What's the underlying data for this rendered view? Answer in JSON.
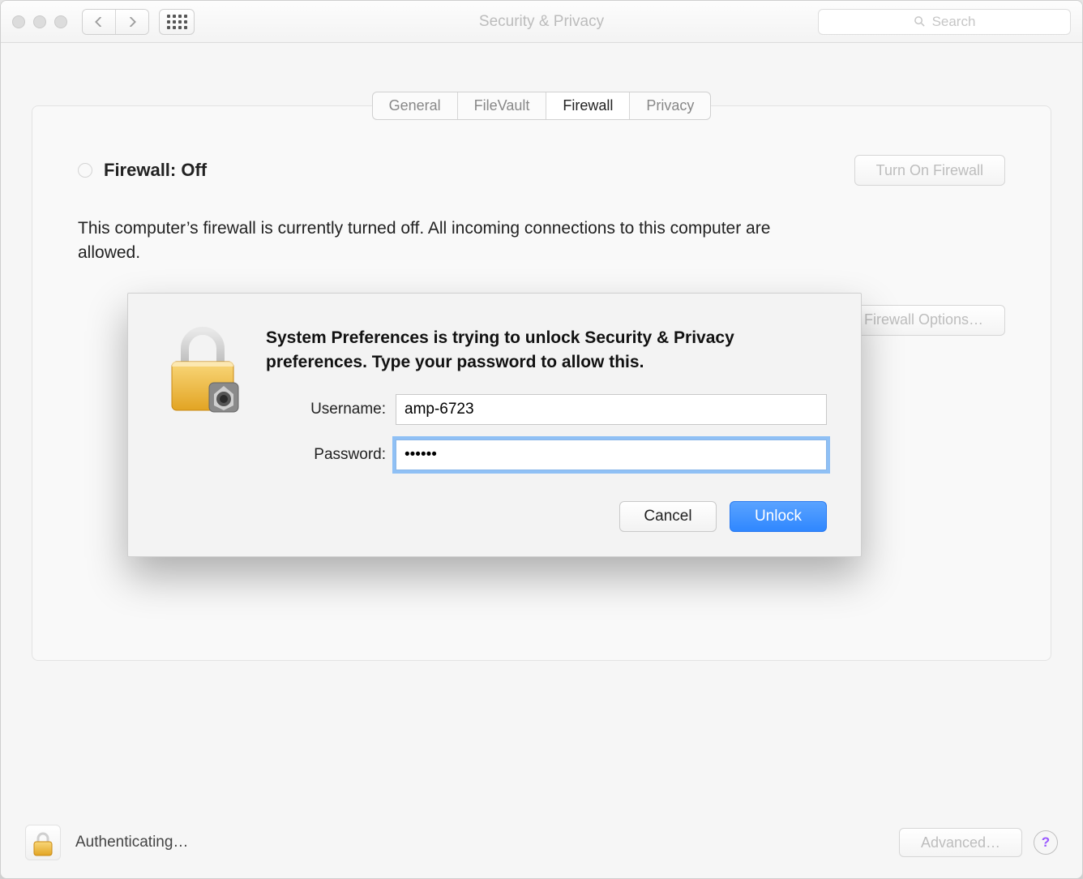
{
  "window": {
    "title": "Security & Privacy",
    "search_placeholder": "Search"
  },
  "tabs": [
    {
      "label": "General",
      "selected": false
    },
    {
      "label": "FileVault",
      "selected": false
    },
    {
      "label": "Firewall",
      "selected": true
    },
    {
      "label": "Privacy",
      "selected": false
    }
  ],
  "firewall": {
    "status_title": "Firewall: Off",
    "toggle_button": "Turn On Firewall",
    "description": "This computer’s firewall is currently turned off. All incoming connections to this computer are allowed.",
    "options_button": "Firewall Options…"
  },
  "footer": {
    "status_text": "Authenticating…",
    "advanced_button": "Advanced…",
    "help_label": "?"
  },
  "dialog": {
    "message": "System Preferences is trying to unlock Security & Privacy preferences. Type your password to allow this.",
    "username_label": "Username:",
    "username_value": "amp-6723",
    "password_label": "Password:",
    "password_value": "••••••",
    "cancel": "Cancel",
    "unlock": "Unlock"
  }
}
